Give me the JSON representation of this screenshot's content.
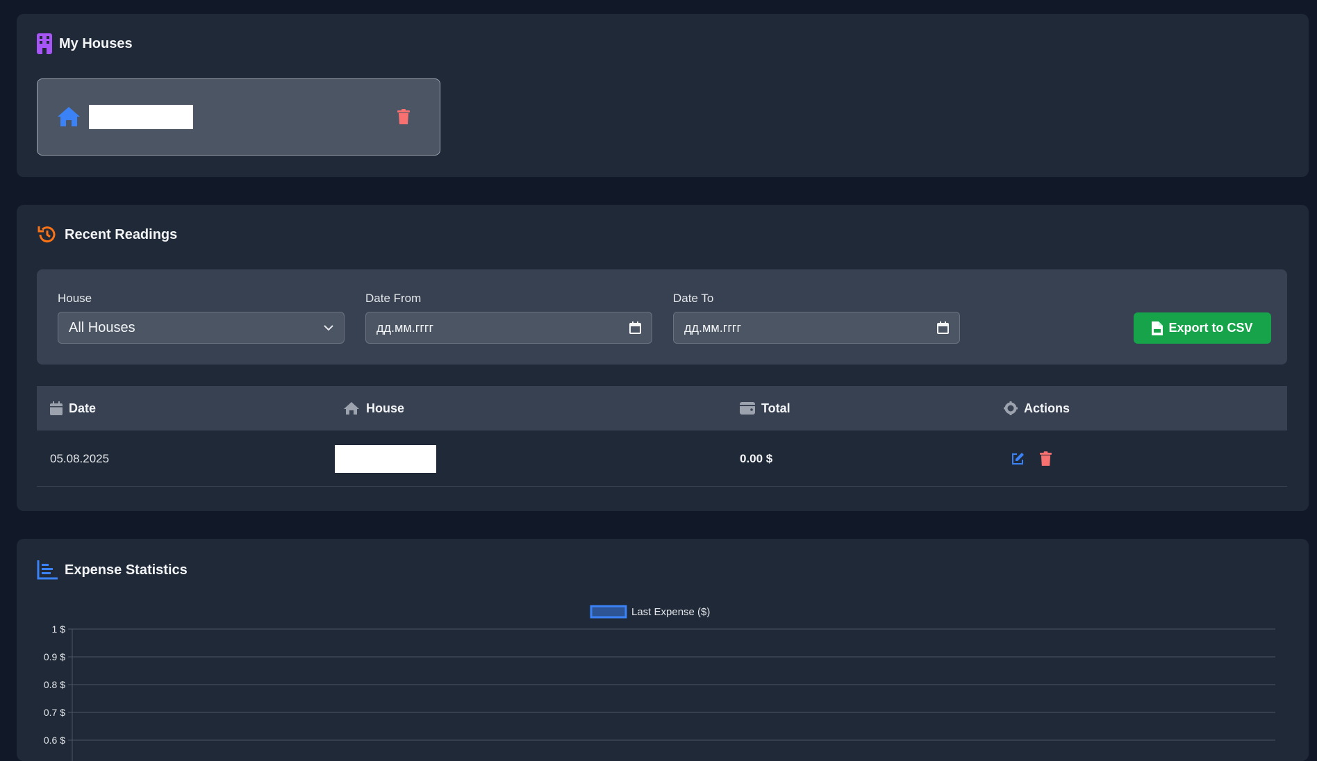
{
  "houses": {
    "title": "My Houses",
    "items": [
      {
        "name": ""
      }
    ]
  },
  "readings": {
    "title": "Recent Readings",
    "filters": {
      "house_label": "House",
      "house_value": "All Houses",
      "date_from_label": "Date From",
      "date_from_placeholder": "дд.мм.гггг",
      "date_to_label": "Date To",
      "date_to_placeholder": "дд.мм.гггг",
      "export_label": "Export to CSV"
    },
    "columns": {
      "date": "Date",
      "house": "House",
      "total": "Total",
      "actions": "Actions"
    },
    "rows": [
      {
        "date": "05.08.2025",
        "house": "",
        "total": "0.00 $"
      }
    ]
  },
  "stats": {
    "title": "Expense Statistics"
  },
  "colors": {
    "accent_purple": "#a855f7",
    "accent_blue": "#3b82f6",
    "accent_orange": "#f97316",
    "danger": "#f87171",
    "success": "#16a34a"
  },
  "chart_data": {
    "type": "bar",
    "legend": [
      "Last Expense ($)"
    ],
    "legend_position": "top-center",
    "series": [
      {
        "name": "Last Expense ($)",
        "values": []
      }
    ],
    "categories": [],
    "ytick_labels": [
      "1 $",
      "0.9 $",
      "0.8 $",
      "0.7 $",
      "0.6 $"
    ],
    "yticks": [
      1,
      0.9,
      0.8,
      0.7,
      0.6
    ],
    "ylim": [
      0,
      1
    ],
    "grid": true
  }
}
